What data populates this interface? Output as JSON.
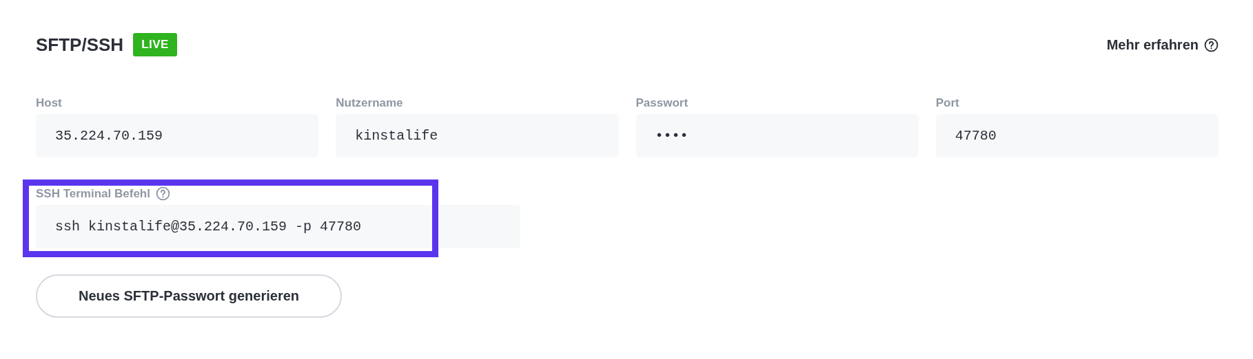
{
  "header": {
    "title": "SFTP/SSH",
    "badge": "LIVE",
    "link": "Mehr erfahren"
  },
  "fields": [
    {
      "label": "Host",
      "value": "35.224.70.159"
    },
    {
      "label": "Nutzername",
      "value": "kinstalife"
    },
    {
      "label": "Passwort",
      "value": "••••"
    },
    {
      "label": "Port",
      "value": "47780"
    }
  ],
  "ssh": {
    "label": "SSH Terminal Befehl",
    "value": "ssh kinstalife@35.224.70.159 -p 47780",
    "highlighted": true
  },
  "button": "Neues SFTP-Passwort generieren"
}
